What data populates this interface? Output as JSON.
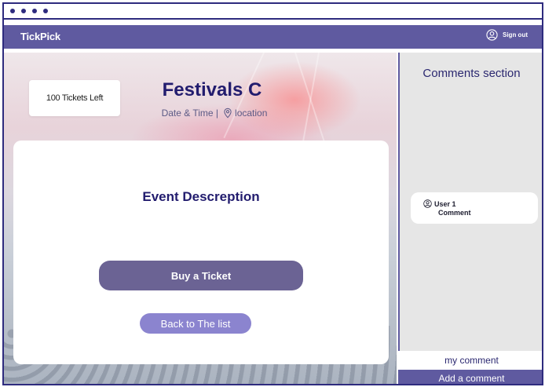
{
  "navbar": {
    "brand": "TickPick",
    "signout_label": "Sign out",
    "signout_icon": "user-circle-icon"
  },
  "event": {
    "tickets_left": "100 Tickets Left",
    "title": "Festivals C",
    "datetime": "Date & Time |",
    "location": "location",
    "location_icon": "location-pin-icon",
    "description": "Event Descreption",
    "buy_label": "Buy a Ticket",
    "back_label": "Back to The list"
  },
  "comments": {
    "title": "Comments section",
    "items": [
      {
        "user": "User 1",
        "text": "Comment",
        "icon": "user-circle-icon"
      }
    ],
    "input_placeholder": "my comment",
    "add_label": "Add a comment"
  },
  "colors": {
    "brand": "#5f5aa0",
    "title": "#221c6e",
    "buy_button": "#6b6394",
    "back_button": "#8b84cf",
    "panel": "#e6e6e6"
  }
}
